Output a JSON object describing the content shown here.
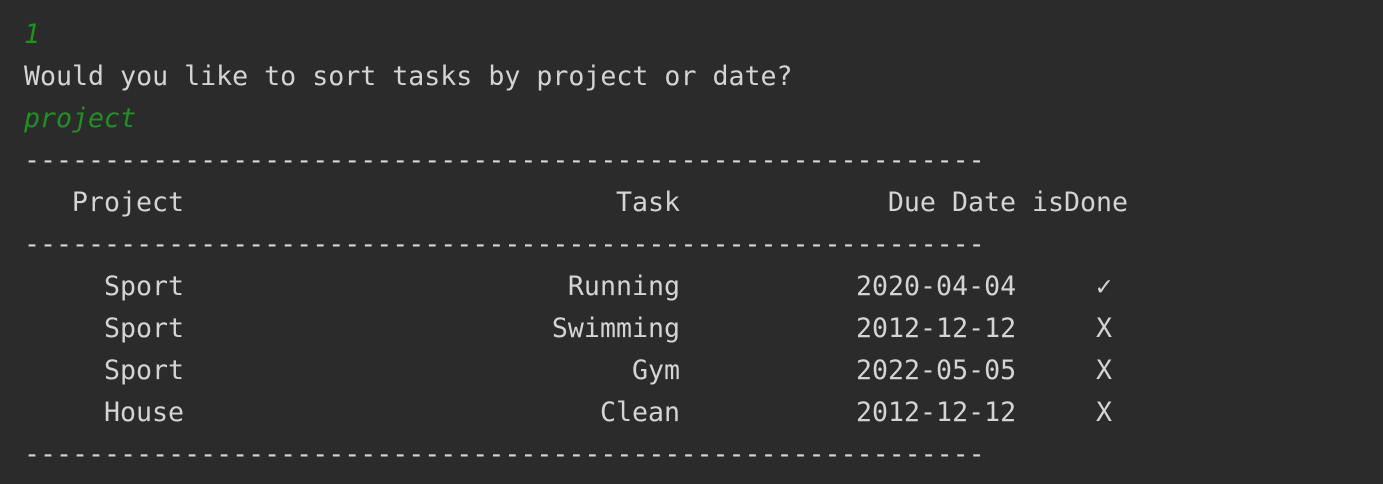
{
  "console": {
    "input_1": "1",
    "prompt": "Would you like to sort tasks by project or date?",
    "input_2": "project",
    "separator": "------------------------------------------------------------"
  },
  "table": {
    "headers": {
      "project": "Project",
      "task": "Task",
      "due_date": "Due Date",
      "is_done": "isDone"
    },
    "rows": [
      {
        "project": "Sport",
        "task": "Running",
        "due_date": "2020-04-04",
        "is_done": "✓"
      },
      {
        "project": "Sport",
        "task": "Swimming",
        "due_date": "2012-12-12",
        "is_done": "X"
      },
      {
        "project": "Sport",
        "task": "Gym",
        "due_date": "2022-05-05",
        "is_done": "X"
      },
      {
        "project": "House",
        "task": "Clean",
        "due_date": "2012-12-12",
        "is_done": "X"
      }
    ]
  },
  "colors": {
    "background": "#2b2b2b",
    "text": "#d4d4d4",
    "user_input": "#1f9120"
  }
}
